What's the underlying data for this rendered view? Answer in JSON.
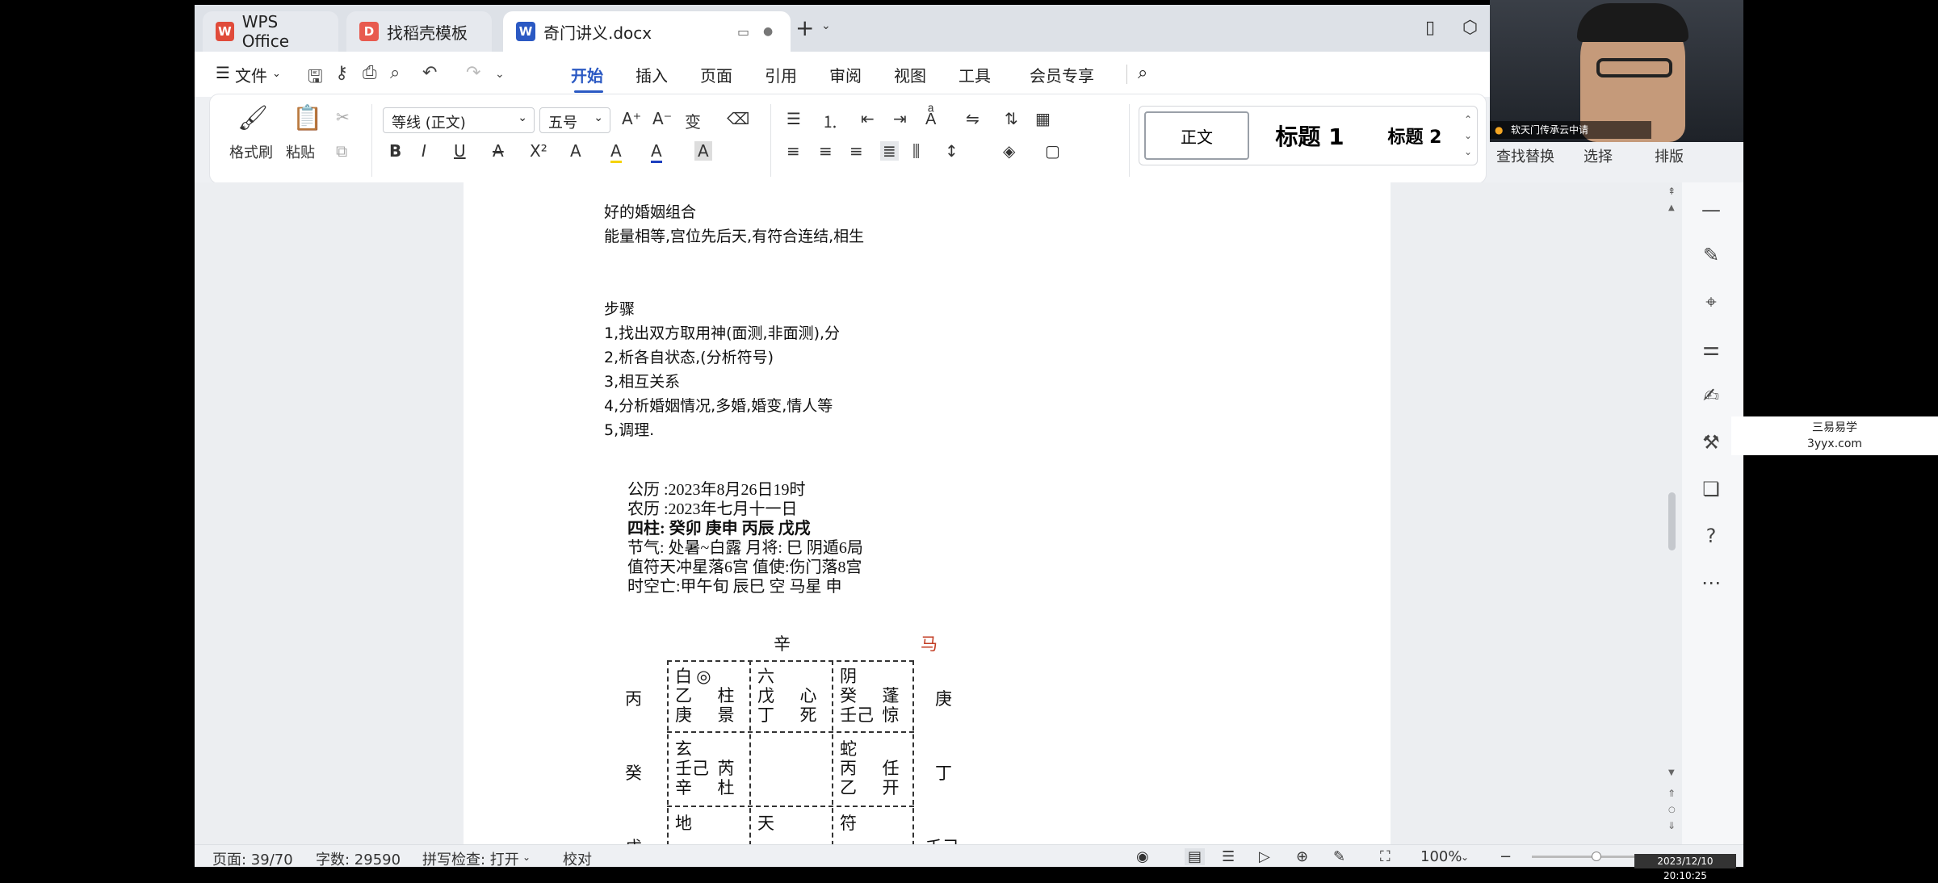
{
  "tabs": [
    {
      "label": "WPS Office"
    },
    {
      "label": "找稻壳模板"
    },
    {
      "label": "奇门讲义.docx"
    }
  ],
  "menu": {
    "file": "文件",
    "items": [
      "开始",
      "插入",
      "页面",
      "引用",
      "审阅",
      "视图",
      "工具",
      "会员专享"
    ]
  },
  "ribbon": {
    "format_painter": "格式刷",
    "paste": "粘贴",
    "font_name": "等线 (正文)",
    "font_size": "五号",
    "style_normal": "正文",
    "style_h1": "标题 1",
    "style_h2": "标题 2",
    "find_replace": "查找替换",
    "select": "选择",
    "arrange": "排版"
  },
  "webcam": {
    "caption": "软天门传承云中请"
  },
  "document": {
    "intro": [
      "好的婚姻组合",
      "能量相等,宫位先后天,有符合连结,相生"
    ],
    "steps_title": "步骤",
    "steps": [
      "1,找出双方取用神(面测,非面测),分",
      "2,析各自状态,(分析符号)",
      "3,相互关系",
      "4,分析婚姻情况,多婚,婚变,情人等",
      "5,调理."
    ],
    "info": [
      "公历 :2023年8月26日19时",
      "农历 :2023年七月十一日",
      "四柱: 癸卯  庚申  丙辰  戊戌",
      "节气: 处暑~白露      月将: 巳   阴遁6局",
      "值符天冲星落6宫  值使:伤门落8宫",
      "时空亡:甲午旬 辰巳 空 马星 申"
    ],
    "grid": {
      "top": "辛",
      "horse": "马",
      "row_labels": [
        "丙",
        "癸",
        "戊"
      ],
      "right_labels": [
        "庚",
        "丁",
        "壬己"
      ],
      "cells": {
        "r1c1": [
          "白  ◎",
          "乙      柱",
          "庚      景"
        ],
        "r1c2": [
          "六",
          "戊      心",
          "丁      死"
        ],
        "r1c3": [
          "阴",
          "癸      蓬",
          "壬己  惊"
        ],
        "r2c1": [
          "玄",
          "壬己  芮",
          "辛      杜"
        ],
        "r2c3": [
          "蛇",
          "丙      任",
          "乙      开"
        ],
        "r3c1": [
          "地"
        ],
        "r3c2": [
          "天"
        ],
        "r3c3": [
          "符"
        ]
      }
    }
  },
  "status": {
    "page": "页面: 39/70",
    "words": "字数: 29590",
    "spell": "拼写检查: 打开",
    "proof": "校对",
    "zoom": "100%"
  },
  "watermark": {
    "line1": "三易易学",
    "line2": "3yyx.com"
  },
  "timestamp": "2023/12/10 20:10:25",
  "colors": {
    "accent": "#2b59c3",
    "red": "#c23b22"
  }
}
